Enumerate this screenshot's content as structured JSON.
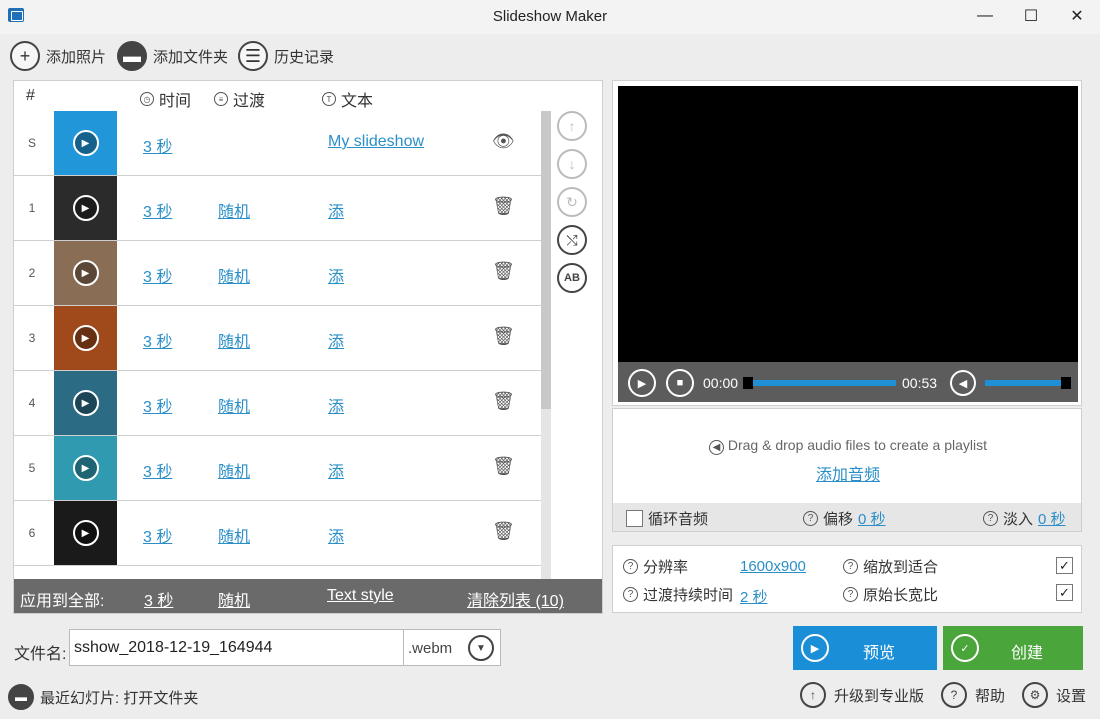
{
  "window": {
    "title": "Slideshow Maker",
    "minimize": "—",
    "maximize": "☐",
    "close": "✕"
  },
  "toolbar": {
    "add_photos": "添加照片",
    "add_folder": "添加文件夹",
    "history": "历史记录"
  },
  "table": {
    "headers": {
      "num": "#",
      "time": "时间",
      "transition": "过渡",
      "text": "文本"
    },
    "rows": [
      {
        "num": "S",
        "duration": "3 秒",
        "transition": "",
        "text": "My slideshow",
        "action": "👁",
        "thumb_color": "#2196d8"
      },
      {
        "num": "1",
        "duration": "3 秒",
        "transition": "随机",
        "text": "添",
        "action": "🗑",
        "thumb_color": "#2b2b2b"
      },
      {
        "num": "2",
        "duration": "3 秒",
        "transition": "随机",
        "text": "添",
        "action": "🗑",
        "thumb_color": "#8a6d55"
      },
      {
        "num": "3",
        "duration": "3 秒",
        "transition": "随机",
        "text": "添",
        "action": "🗑",
        "thumb_color": "#a04a1c"
      },
      {
        "num": "4",
        "duration": "3 秒",
        "transition": "随机",
        "text": "添",
        "action": "🗑",
        "thumb_color": "#2c6b84"
      },
      {
        "num": "5",
        "duration": "3 秒",
        "transition": "随机",
        "text": "添",
        "action": "🗑",
        "thumb_color": "#2f9ab0"
      },
      {
        "num": "6",
        "duration": "3 秒",
        "transition": "随机",
        "text": "添",
        "action": "🗑",
        "thumb_color": "#1a1a1a"
      }
    ]
  },
  "apply_bar": {
    "label": "应用到全部:",
    "duration": "3 秒",
    "transition": "随机",
    "text_style": "Text style",
    "clear": "清除列表 (10)"
  },
  "filename": {
    "label": "文件名:",
    "value": "sshow_2018-12-19_164944",
    "ext": ".webm"
  },
  "recent": "最近幻灯片: 打开文件夹",
  "player": {
    "current_time": "00:00",
    "total_time": "00:53",
    "progress": 0,
    "volume": 0.93
  },
  "audio": {
    "drop_text": "Drag & drop audio files to create a playlist",
    "add_audio": "添加音频",
    "loop": "循环音频",
    "offset_label": "偏移",
    "offset_value": "0 秒",
    "fadein_label": "淡入",
    "fadein_value": "0 秒"
  },
  "settings": {
    "resolution_label": "分辨率",
    "resolution_value": "1600x900",
    "scale_label": "缩放到适合",
    "transition_dur_label": "过渡持续时间",
    "transition_dur_value": "2 秒",
    "aspect_label": "原始长宽比"
  },
  "actions": {
    "preview": "预览",
    "create": "创建",
    "upgrade": "升级到专业版",
    "help": "帮助",
    "settings": "设置"
  }
}
